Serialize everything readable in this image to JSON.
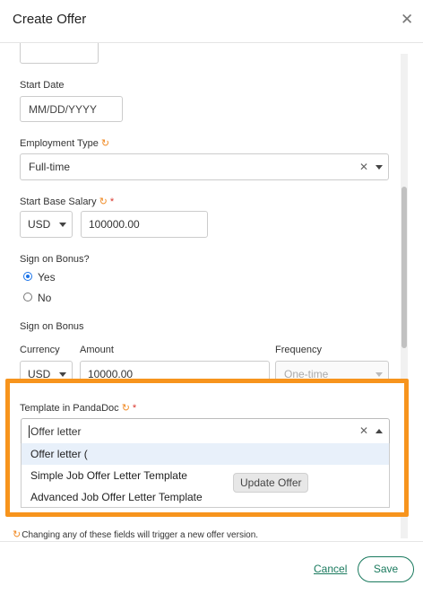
{
  "dialog": {
    "title": "Create Offer",
    "close_glyph": "✕"
  },
  "form": {
    "start_date": {
      "label": "Start Date",
      "placeholder": "MM/DD/YYYY"
    },
    "employment_type": {
      "label": "Employment Type",
      "value": "Full-time"
    },
    "start_base_salary": {
      "label": "Start Base Salary",
      "currency": "USD",
      "amount": "100000.00"
    },
    "sign_on_bonus_question": {
      "label": "Sign on Bonus?",
      "options": [
        "Yes",
        "No"
      ],
      "selected": "Yes"
    },
    "sign_on_bonus": {
      "label": "Sign on Bonus",
      "currency_label": "Currency",
      "amount_label": "Amount",
      "frequency_label": "Frequency",
      "currency": "USD",
      "amount": "10000.00",
      "frequency": "One-time"
    },
    "template": {
      "label": "Template in PandaDoc",
      "input_value": "Offer letter",
      "options": [
        "Offer letter (",
        "Simple Job Offer Letter Template",
        "Advanced Job Offer Letter Template"
      ],
      "highlighted_index": 0
    }
  },
  "icons": {
    "sync": "sync-icon",
    "clear": "clear-icon",
    "close": "close-icon"
  },
  "tooltip": "Update Offer",
  "footnote": "Changing any of these fields will trigger a new offer version.",
  "footer": {
    "cancel_label": "Cancel",
    "save_label": "Save"
  },
  "colors": {
    "accent": "#1a7a5e",
    "highlight_border": "#f7941d",
    "sync": "#f08a24",
    "radio": "#1a73e8"
  }
}
